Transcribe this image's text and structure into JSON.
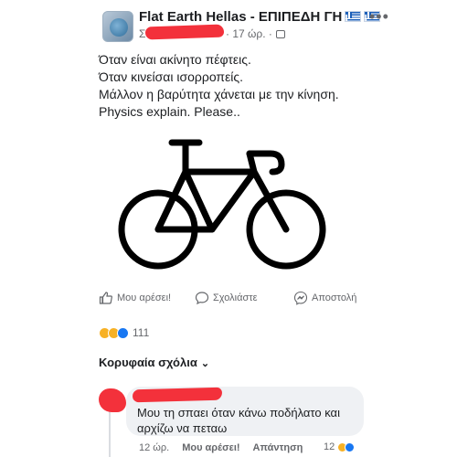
{
  "post": {
    "group_name": "Flat Earth Hellas - ΕΠΙΠΕΔΗ ΓΗ",
    "author_initial": "Σ",
    "time": "· 17 ώρ. ·",
    "more": "•••",
    "text_lines": [
      "Όταν είναι ακίνητο πέφτεις.",
      "Όταν κινείσαι ισορροπείς.",
      "Μάλλον η βαρύτητα χάνεται με την κίνηση.",
      "Physics explain. Please.."
    ],
    "image_icon": "bicycle-icon"
  },
  "actions": {
    "like": "Μου αρέσει!",
    "comment": "Σχολιάστε",
    "share": "Αποστολή"
  },
  "reactions": {
    "count": "111",
    "types": [
      "haha",
      "sad",
      "like"
    ]
  },
  "comments": {
    "filter_label": "Κορυφαία σχόλια",
    "items": [
      {
        "text_lines": [
          "Μου τη σπαει όταν κάνω ποδήλατο και",
          "αρχίζω να πεταω"
        ],
        "time": "12 ώρ.",
        "like": "Μου αρέσει!",
        "reply": "Απάντηση",
        "reaction_count": "12"
      }
    ]
  },
  "colors": {
    "redaction": "#f3313b",
    "muted_text": "#65676b",
    "bubble": "#eff1f4",
    "like_blue": "#1877f2",
    "emoji_yellow": "#f7b125"
  }
}
